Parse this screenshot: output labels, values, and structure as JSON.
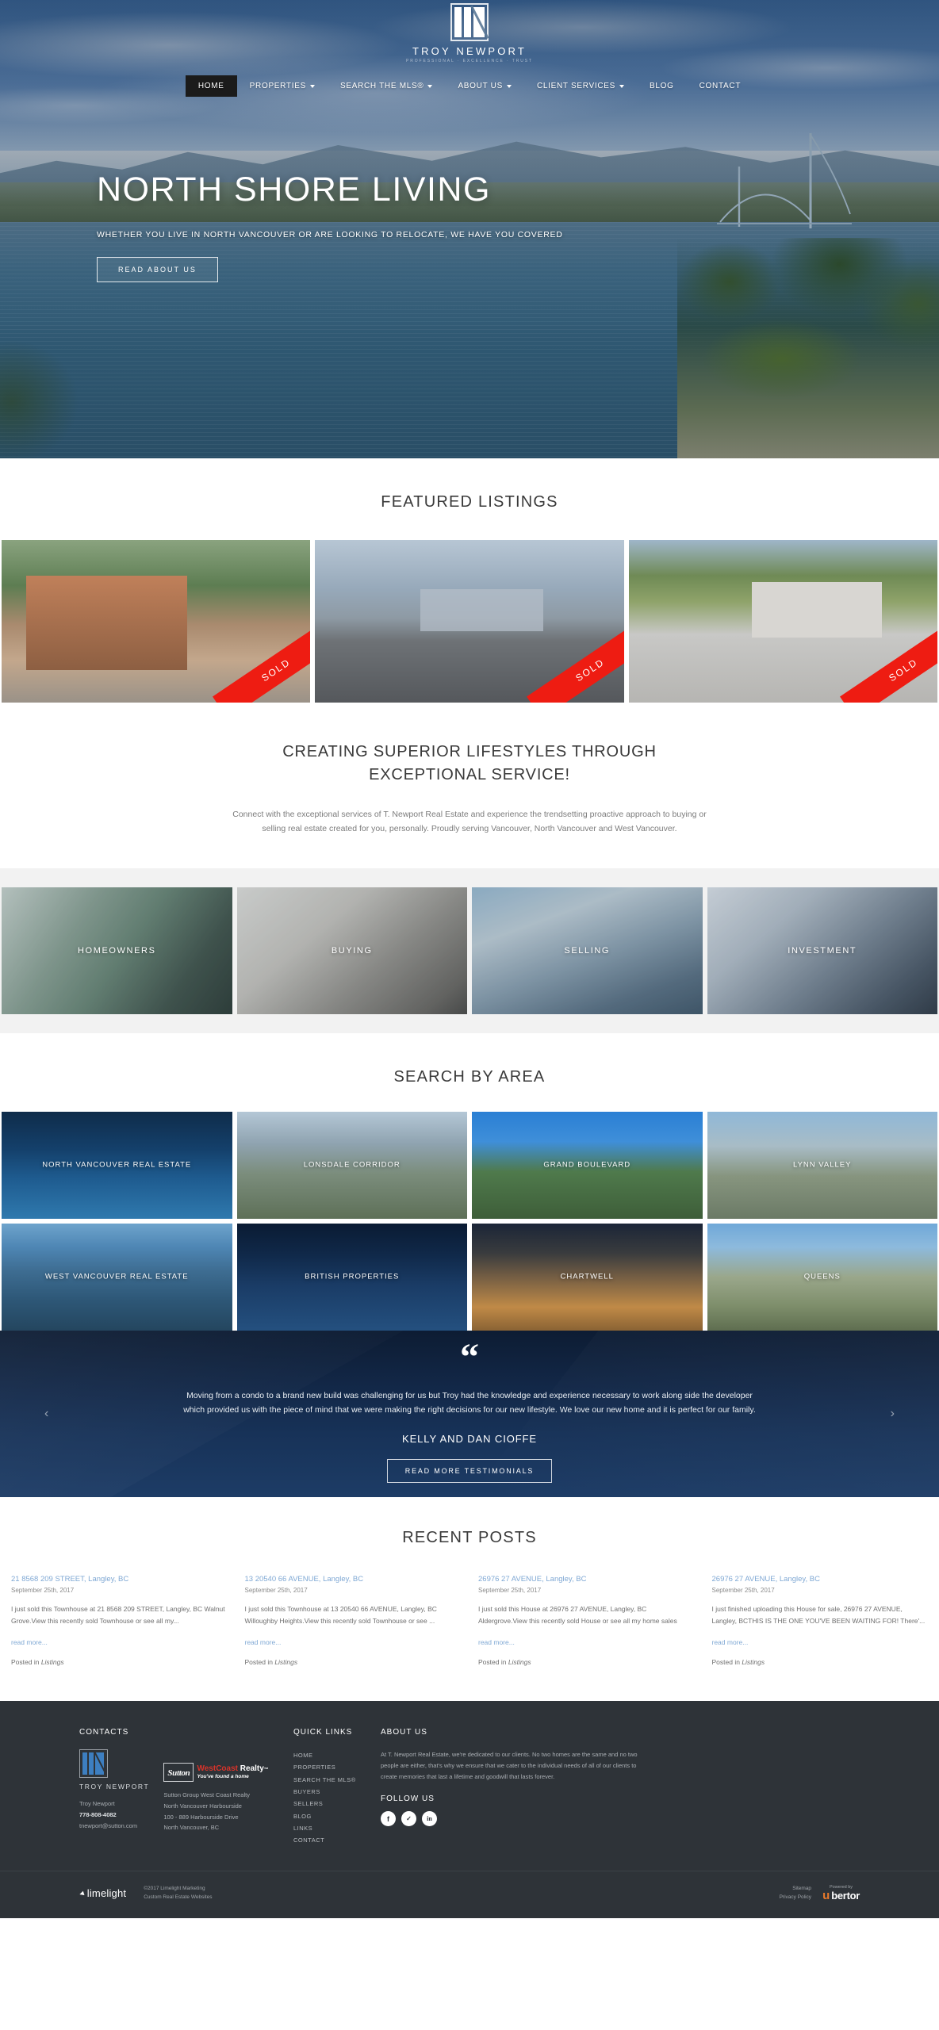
{
  "brand": {
    "name": "TROY NEWPORT",
    "tagline": "PROFESSIONAL · EXCELLENCE · TRUST"
  },
  "nav": {
    "items": [
      {
        "label": "HOME",
        "active": true,
        "caret": false
      },
      {
        "label": "PROPERTIES",
        "active": false,
        "caret": true
      },
      {
        "label": "SEARCH THE MLS®",
        "active": false,
        "caret": true
      },
      {
        "label": "ABOUT US",
        "active": false,
        "caret": true
      },
      {
        "label": "CLIENT SERVICES",
        "active": false,
        "caret": true
      },
      {
        "label": "BLOG",
        "active": false,
        "caret": false
      },
      {
        "label": "CONTACT",
        "active": false,
        "caret": false
      }
    ]
  },
  "hero": {
    "title": "NORTH SHORE LIVING",
    "subtitle": "WHETHER YOU LIVE IN NORTH VANCOUVER OR ARE LOOKING TO RELOCATE, WE HAVE YOU COVERED",
    "button": "READ ABOUT US"
  },
  "featured": {
    "title": "FEATURED LISTINGS",
    "listings": [
      {
        "badge": "SOLD"
      },
      {
        "badge": "SOLD"
      },
      {
        "badge": "SOLD"
      }
    ]
  },
  "superior": {
    "heading_line1": "CREATING SUPERIOR LIFESTYLES THROUGH",
    "heading_line2": "EXCEPTIONAL SERVICE!",
    "body": "Connect with the exceptional services of T. Newport Real Estate and experience the trendsetting proactive approach to buying or selling real estate created for you, personally. Proudly serving Vancouver, North Vancouver and West Vancouver."
  },
  "categories": [
    {
      "label": "HOMEOWNERS"
    },
    {
      "label": "BUYING"
    },
    {
      "label": "SELLING"
    },
    {
      "label": "INVESTMENT"
    }
  ],
  "areas": {
    "title": "SEARCH BY AREA",
    "items": [
      {
        "label": "NORTH VANCOUVER REAL ESTATE"
      },
      {
        "label": "LONSDALE CORRIDOR"
      },
      {
        "label": "GRAND BOULEVARD"
      },
      {
        "label": "LYNN VALLEY"
      },
      {
        "label": "WEST VANCOUVER REAL ESTATE"
      },
      {
        "label": "BRITISH PROPERTIES"
      },
      {
        "label": "CHARTWELL"
      },
      {
        "label": "QUEENS"
      }
    ]
  },
  "testimonial": {
    "quote_glyph": "“",
    "text": "Moving from a condo to a brand new build was challenging for us but Troy had the knowledge and experience necessary to work along side the developer which provided us with the piece of mind that we were making the right decisions for our new lifestyle. We love our new home and it is perfect for our family.",
    "author": "KELLY AND DAN CIOFFE",
    "button": "READ MORE TESTIMONIALS",
    "prev_arrow": "‹",
    "next_arrow": "›"
  },
  "posts": {
    "title": "RECENT POSTS",
    "items": [
      {
        "title": "21 8568 209 STREET, Langley, BC",
        "date": "September 25th, 2017",
        "excerpt": "I just sold this Townhouse at 21 8568 209 STREET, Langley, BC Walnut Grove.View this recently sold Townhouse or see all my...",
        "more": "read more...",
        "posted_prefix": "Posted in ",
        "category": "Listings"
      },
      {
        "title": "13 20540 66 AVENUE, Langley, BC",
        "date": "September 25th, 2017",
        "excerpt": "I just sold this Townhouse at 13 20540 66 AVENUE, Langley, BC Willoughby Heights.View this recently sold Townhouse or see ...",
        "more": "read more...",
        "posted_prefix": "Posted in ",
        "category": "Listings"
      },
      {
        "title": "26976 27 AVENUE, Langley, BC",
        "date": "September 25th, 2017",
        "excerpt": "I just sold this House at 26976 27 AVENUE, Langley, BC Aldergrove.View this recently sold House or see all my home sales",
        "more": "read more...",
        "posted_prefix": "Posted in ",
        "category": "Listings"
      },
      {
        "title": "26976 27 AVENUE, Langley, BC",
        "date": "September 25th, 2017",
        "excerpt": "I just finished uploading this House for sale, 26976 27 AVENUE, Langley, BCTHIS IS THE ONE YOU'VE BEEN WAITING FOR! There'...",
        "more": "read more...",
        "posted_prefix": "Posted in ",
        "category": "Listings"
      }
    ]
  },
  "footer": {
    "contacts": {
      "heading": "CONTACTS",
      "logo_name": "TROY NEWPORT",
      "agent": "Troy Newport",
      "phone": "778-808-4082",
      "email": "tnewport@sutton.com",
      "brokerage_logo": {
        "sutton": "Sutton",
        "west": "West",
        "coast": "Coast",
        "realty": "Realty",
        "tm": "™",
        "slogan": "You've found a home"
      },
      "brokerage_lines": [
        "Sutton Group West Coast Realty",
        "North Vancouver Harbourside",
        "100 - 889 Harbourside Drive",
        "North Vancouver, BC"
      ]
    },
    "quick_links": {
      "heading": "QUICK LINKS",
      "items": [
        "HOME",
        "PROPERTIES",
        "SEARCH THE MLS®",
        "BUYERS",
        "SELLERS",
        "BLOG",
        "LINKS",
        "CONTACT"
      ]
    },
    "about": {
      "heading": "ABOUT US",
      "text": "At T. Newport Real Estate, we're dedicated to our clients. No two homes are the same and no two people are either, that's why we ensure that we cater to the individual needs of all of our clients to create memories that last a lifetime and goodwill that lasts forever.",
      "follow_heading": "FOLLOW US",
      "socials": [
        {
          "name": "facebook",
          "glyph": "f"
        },
        {
          "name": "twitter",
          "glyph": "✓"
        },
        {
          "name": "linkedin",
          "glyph": "in"
        }
      ]
    },
    "bottom": {
      "limelight_name": "limelight",
      "copyright_line1": "©2017 Limelight Marketing",
      "copyright_line2": "Custom Real Estate Websites",
      "links": [
        "Sitemap",
        "Privacy Policy"
      ],
      "powered_by": "Powered by",
      "ubertor_u": "u",
      "ubertor_rest": "bertor"
    }
  }
}
